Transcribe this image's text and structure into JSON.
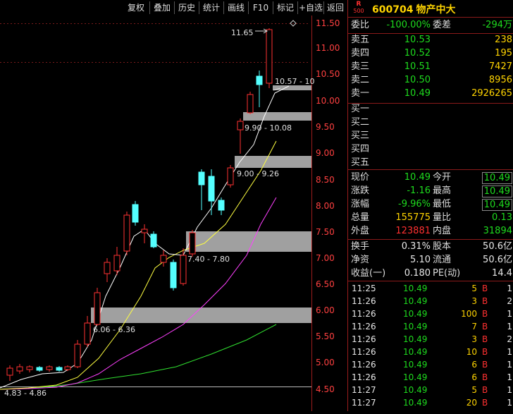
{
  "toolbar": {
    "buttons": [
      "复权",
      "叠加",
      "历史",
      "统计",
      "画线",
      "F10",
      "标记",
      "+自选",
      "返回"
    ]
  },
  "chart": {
    "price_axis": [
      "11.50",
      "11.00",
      "10.50",
      "10.00",
      "9.50",
      "9.00",
      "8.50",
      "8.00",
      "7.50",
      "7.00",
      "6.50",
      "6.00",
      "5.50",
      "5.00",
      "4.50"
    ],
    "annotations": {
      "high": "11.65",
      "zone1": "10.57 - 10",
      "zone2": "9.90 - 10.08",
      "zone3": "9.00 - 9.26",
      "zone4": "7.40 - 7.80",
      "zone5": "6.06 - 6.36",
      "zone6": "4.83 - 4.86"
    },
    "colors": {
      "up": "#ff3232",
      "down": "#54ffff",
      "ma5": "#ffffff",
      "ma10": "#ffff40",
      "ma20": "#ff40ff",
      "ma60": "#30e030",
      "zone": "#a0a0a0"
    }
  },
  "quote": {
    "r_label": "R",
    "r_num": "500",
    "code": "600704",
    "name": "物产中大",
    "weibi_label": "委比",
    "weibi": "-100.00%",
    "weicha_label": "委差",
    "weicha": "-294万",
    "asks": [
      {
        "label": "卖五",
        "price": "10.53",
        "vol": "238"
      },
      {
        "label": "卖四",
        "price": "10.52",
        "vol": "195"
      },
      {
        "label": "卖三",
        "price": "10.51",
        "vol": "7427"
      },
      {
        "label": "卖二",
        "price": "10.50",
        "vol": "8956"
      },
      {
        "label": "卖一",
        "price": "10.49",
        "vol": "2926265"
      }
    ],
    "bids": [
      "买一",
      "买二",
      "买三",
      "买四",
      "买五"
    ],
    "stats": [
      {
        "l1": "现价",
        "v1": "10.49",
        "l2": "今开",
        "v2": "10.49"
      },
      {
        "l1": "涨跌",
        "v1": "-1.16",
        "l2": "最高",
        "v2": "10.49"
      },
      {
        "l1": "涨幅",
        "v1": "-9.96%",
        "l2": "最低",
        "v2": "10.49"
      },
      {
        "l1": "总量",
        "v1": "155775",
        "l2": "量比",
        "v2": "0.13"
      },
      {
        "l1": "外盘",
        "v1": "123881",
        "l2": "内盘",
        "v2": "31894"
      }
    ],
    "fin": [
      {
        "l1": "换手",
        "v1": "0.31%",
        "l2": "股本",
        "v2": "50.6亿"
      },
      {
        "l1": "净资",
        "v1": "5.10",
        "l2": "流通",
        "v2": "50.6亿"
      },
      {
        "l1": "收益(一)",
        "v1": "0.180",
        "l2": "PE(动)",
        "v2": "14.4"
      }
    ],
    "ticks": [
      {
        "time": "11:25",
        "price": "10.49",
        "vol": "5",
        "bs": "B",
        "cnt": "1"
      },
      {
        "time": "11:26",
        "price": "10.49",
        "vol": "3",
        "bs": "B",
        "cnt": "2"
      },
      {
        "time": "11:26",
        "price": "10.49",
        "vol": "100",
        "bs": "B",
        "cnt": "1"
      },
      {
        "time": "11:26",
        "price": "10.49",
        "vol": "7",
        "bs": "B",
        "cnt": "1"
      },
      {
        "time": "11:26",
        "price": "10.49",
        "vol": "3",
        "bs": "B",
        "cnt": "2"
      },
      {
        "time": "11:26",
        "price": "10.49",
        "vol": "10",
        "bs": "B",
        "cnt": "1"
      },
      {
        "time": "11:26",
        "price": "10.49",
        "vol": "6",
        "bs": "B",
        "cnt": "1"
      },
      {
        "time": "11:26",
        "price": "10.49",
        "vol": "6",
        "bs": "B",
        "cnt": "1"
      },
      {
        "time": "11:27",
        "price": "10.49",
        "vol": "5",
        "bs": "B",
        "cnt": "1"
      },
      {
        "time": "11:27",
        "price": "10.49",
        "vol": "20",
        "bs": "B",
        "cnt": "1"
      }
    ]
  }
}
